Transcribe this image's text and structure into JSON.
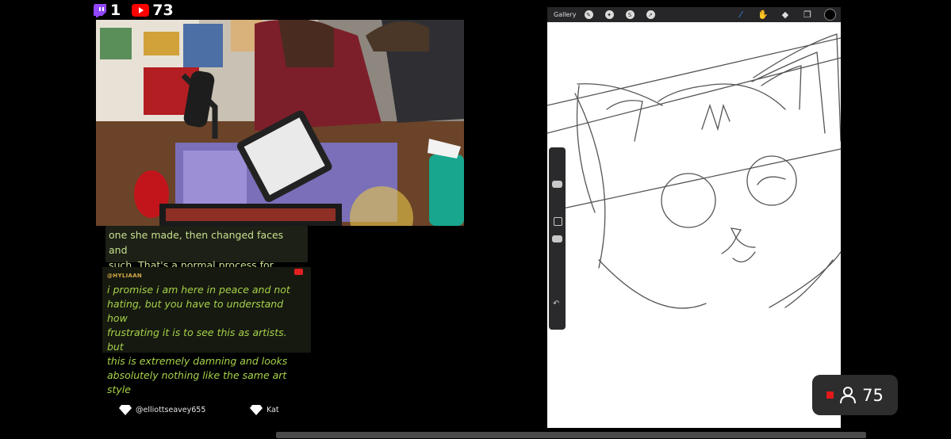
{
  "stats": {
    "twitch_count": "1",
    "youtube_count": "73"
  },
  "chat": {
    "partial_message": "They're saying the duplicated the first one she made, then changed faces and such. That's a normal process for emotes.",
    "partial_lines": [
      "one she made, then changed faces and",
      "such. That's a normal process for emotes."
    ],
    "message": {
      "username": "@HYLIAAN",
      "lines": [
        "i promise i am here in peace and not",
        "hating, but you have to understand how",
        "frustrating it is to see this as artists. but",
        "this is extremely damning and looks",
        "absolutely nothing like the same art style"
      ]
    }
  },
  "gifts": [
    {
      "name": "@elliottseavey655"
    },
    {
      "name": "Kat"
    }
  ],
  "procreate": {
    "gallery_label": "Gallery",
    "left_tools": [
      "wrench-icon",
      "magic-wand-icon",
      "selection-icon",
      "transform-icon"
    ],
    "right_tools": [
      "brush-icon",
      "smudge-icon",
      "eraser-icon",
      "layers-icon"
    ],
    "active_color": "#000000",
    "brush_accent": "#3a8df0"
  },
  "viewers": {
    "count": "75",
    "live_color": "#e31919"
  }
}
